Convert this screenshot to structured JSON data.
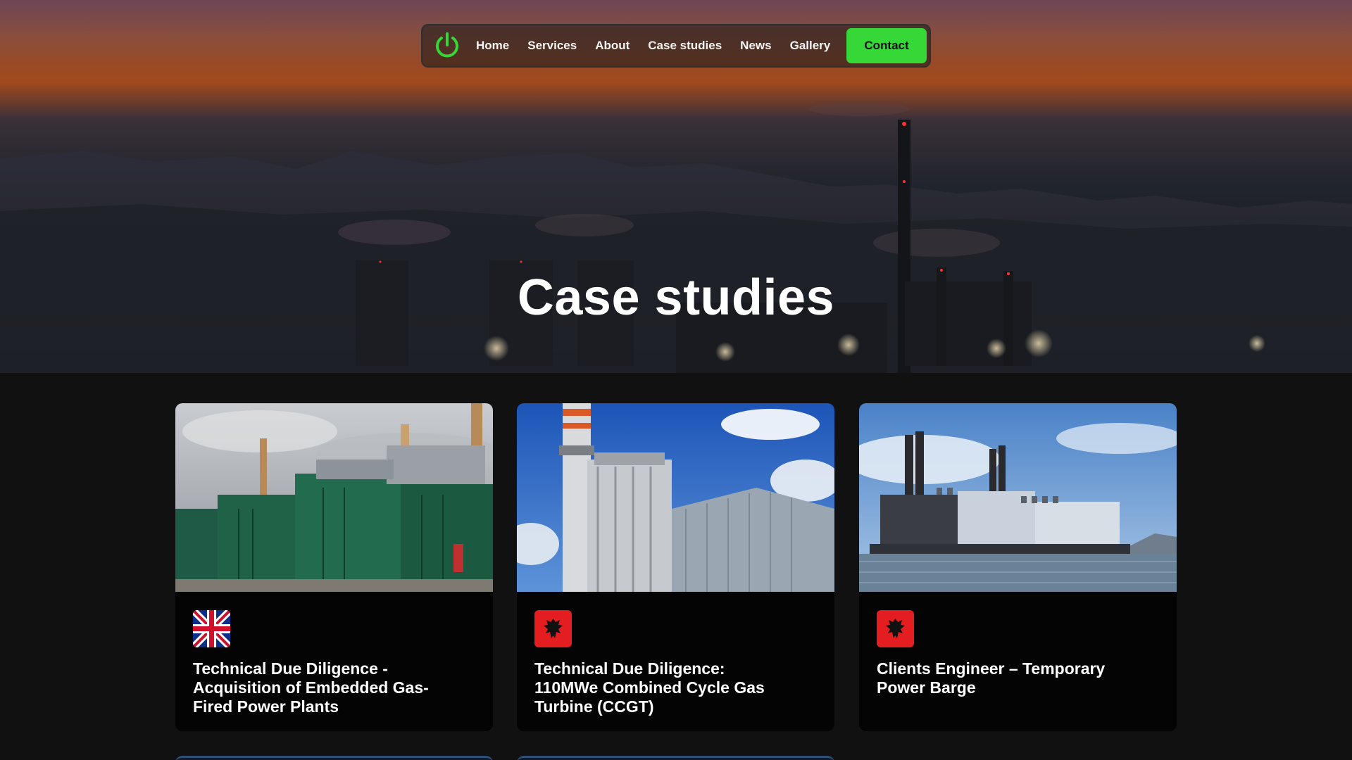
{
  "nav": {
    "logo_icon": "power-icon",
    "links": [
      "Home",
      "Services",
      "About",
      "Case studies",
      "News",
      "Gallery"
    ],
    "contact_label": "Contact",
    "accent": "#35d836"
  },
  "hero": {
    "title": "Case studies"
  },
  "cards": [
    {
      "flag_icon": "uk-flag-icon",
      "title": "Technical Due Diligence - Acquisition of Embedded Gas-Fired Power Plants",
      "image_icon": "gas-engine-plant-photo"
    },
    {
      "flag_icon": "albania-flag-icon",
      "title": "Technical Due Diligence: 110MWe Combined Cycle Gas Turbine (CCGT)",
      "image_icon": "ccgt-turbine-photo"
    },
    {
      "flag_icon": "albania-flag-icon",
      "title": "Clients Engineer – Temporary Power Barge",
      "image_icon": "power-barge-photo"
    }
  ]
}
